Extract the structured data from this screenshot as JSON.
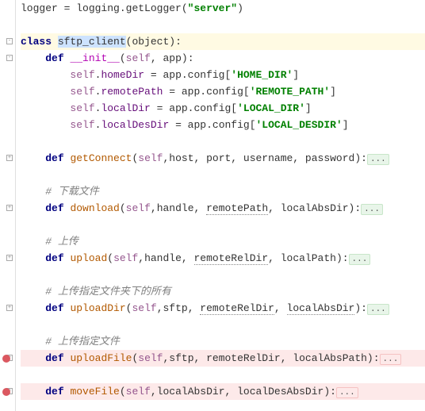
{
  "code": {
    "line1": {
      "var": "logger",
      "eq": " = ",
      "mod": "logging",
      "dot": ".",
      "call": "getLogger",
      "paren_open": "(",
      "str": "\"server\"",
      "paren_close": ")"
    },
    "line3": {
      "kw": "class ",
      "name": "sftp_client",
      "paren_open": "(",
      "base": "object",
      "paren_close": "):"
    },
    "line4": {
      "indent": "    ",
      "kw": "def ",
      "name": "__init__",
      "sig": "(",
      "self": "self",
      "rest": ", app):"
    },
    "line5": {
      "indent": "        ",
      "self": "self",
      "dot": ".",
      "field": "homeDir",
      "eq": " = app.config[",
      "str": "'HOME_DIR'",
      "end": "]"
    },
    "line6": {
      "indent": "        ",
      "self": "self",
      "dot": ".",
      "field": "remotePath",
      "eq": " = app.config[",
      "str": "'REMOTE_PATH'",
      "end": "]"
    },
    "line7": {
      "indent": "        ",
      "self": "self",
      "dot": ".",
      "field": "localDir",
      "eq": " = app.config[",
      "str": "'LOCAL_DIR'",
      "end": "]"
    },
    "line8": {
      "indent": "        ",
      "self": "self",
      "dot": ".",
      "field": "localDesDir",
      "eq": " = app.config[",
      "str": "'LOCAL_DESDIR'",
      "end": "]"
    },
    "line10": {
      "indent": "    ",
      "kw": "def ",
      "name": "getConnect",
      "open": "(",
      "self": "self",
      "params": ",host, port, username, password):",
      "fold": "..."
    },
    "line12": {
      "indent": "    ",
      "text": "# 下载文件"
    },
    "line13": {
      "indent": "    ",
      "kw": "def ",
      "name": "download",
      "open": "(",
      "self": "self",
      "p1": ",handle, ",
      "p2": "remotePath",
      "p3": ", localAbsDir):",
      "fold": "..."
    },
    "line15": {
      "indent": "    ",
      "text": "# 上传"
    },
    "line16": {
      "indent": "    ",
      "kw": "def ",
      "name": "upload",
      "open": "(",
      "self": "self",
      "p1": ",handle, ",
      "p2": "remoteRelDir",
      "p3": ", localPath):",
      "fold": "..."
    },
    "line18": {
      "indent": "    ",
      "text": "# 上传指定文件夹下的所有"
    },
    "line19": {
      "indent": "    ",
      "kw": "def ",
      "name": "uploadDir",
      "open": "(",
      "self": "self",
      "p1": ",sftp, ",
      "p2": "remoteRelDir",
      "p3": ", ",
      "p4": "localAbsDir",
      "p5": "):",
      "fold": "..."
    },
    "line21": {
      "indent": "    ",
      "text": "# 上传指定文件"
    },
    "line22": {
      "indent": "    ",
      "kw": "def ",
      "name": "uploadFile",
      "open": "(",
      "self": "self",
      "p1": ",sftp, remoteRelDir, localAbsPath):",
      "fold": "..."
    },
    "line24": {
      "indent": "    ",
      "kw": "def ",
      "name": "moveFile",
      "open": "(",
      "self": "self",
      "p1": ",localAbsDir, localDesAbsDir):",
      "fold": "..."
    }
  }
}
